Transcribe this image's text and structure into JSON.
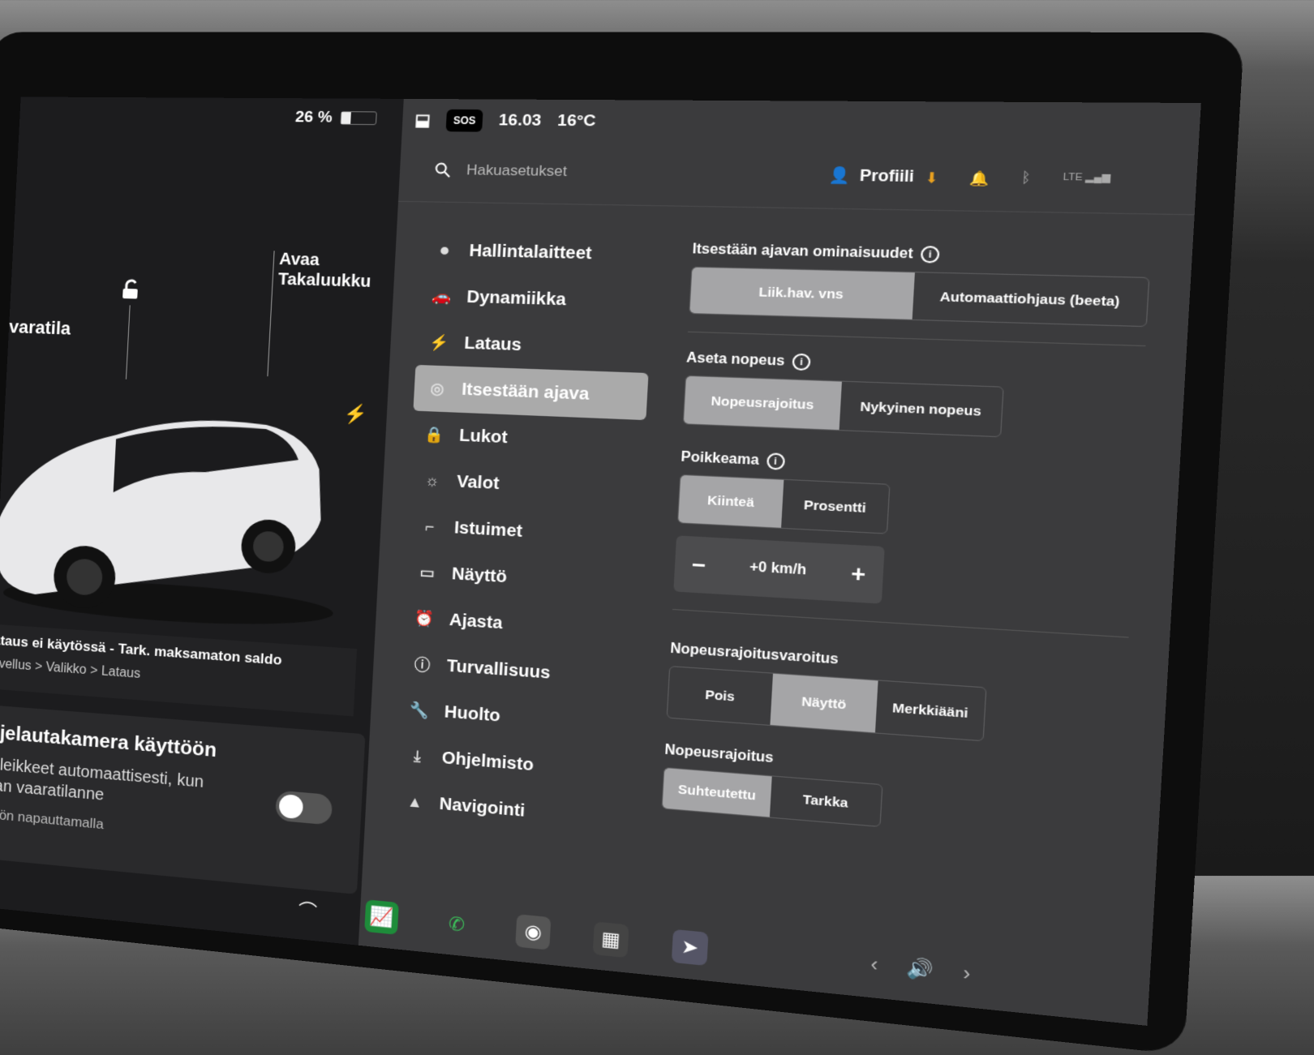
{
  "status": {
    "battery_percent": "26 %",
    "battery_level": 0.26,
    "sos": "SOS",
    "time": "16.03",
    "temperature": "16°C"
  },
  "car": {
    "label_left": "varatila",
    "label_trunk": "Avaa Takaluukku",
    "notice_line1": "ataus ei käytössä - Tark. maksamaton saldo",
    "notice_line2": "ovellus > Valikko > Lataus",
    "camera_title": "ojelautakamera käyttöön",
    "camera_desc1": "a leikkeet automaattisesti, kun",
    "camera_desc2": "aan vaaratilanne",
    "camera_desc3": "ttöön napauttamalla"
  },
  "topbar": {
    "search_placeholder": "Hakuasetukset",
    "profile_label": "Profiili",
    "signal_label": "LTE"
  },
  "nav": {
    "items": [
      {
        "label": "Hallintalaitteet",
        "icon": "toggle-icon"
      },
      {
        "label": "Dynamiikka",
        "icon": "car-icon"
      },
      {
        "label": "Lataus",
        "icon": "bolt-icon"
      },
      {
        "label": "Itsestään ajava",
        "icon": "steering-wheel-icon"
      },
      {
        "label": "Lukot",
        "icon": "lock-icon"
      },
      {
        "label": "Valot",
        "icon": "sun-icon"
      },
      {
        "label": "Istuimet",
        "icon": "seat-icon"
      },
      {
        "label": "Näyttö",
        "icon": "display-icon"
      },
      {
        "label": "Ajasta",
        "icon": "alarm-icon"
      },
      {
        "label": "Turvallisuus",
        "icon": "alert-icon"
      },
      {
        "label": "Huolto",
        "icon": "wrench-icon"
      },
      {
        "label": "Ohjelmisto",
        "icon": "download-icon"
      },
      {
        "label": "Navigointi",
        "icon": "navigation-icon"
      }
    ],
    "active_index": 3
  },
  "autopilot": {
    "features_title": "Itsestään ajavan ominaisuudet",
    "features_options": [
      "Liik.hav. vns",
      "Automaattiohjaus (beeta)"
    ],
    "features_selected": 0,
    "speed_title": "Aseta nopeus",
    "speed_options": [
      "Nopeusrajoitus",
      "Nykyinen nopeus"
    ],
    "speed_selected": 0,
    "offset_title": "Poikkeama",
    "offset_options": [
      "Kiinteä",
      "Prosentti"
    ],
    "offset_selected": 0,
    "offset_value": "+0 km/h",
    "warning_title": "Nopeusrajoitusvaroitus",
    "warning_options": [
      "Pois",
      "Näyttö",
      "Merkkiääni"
    ],
    "warning_selected": 1,
    "limit_title": "Nopeusrajoitus",
    "limit_options": [
      "Suhteutettu",
      "Tarkka"
    ],
    "limit_selected": 0
  },
  "dock": {
    "volume_icon": "speaker-icon"
  }
}
